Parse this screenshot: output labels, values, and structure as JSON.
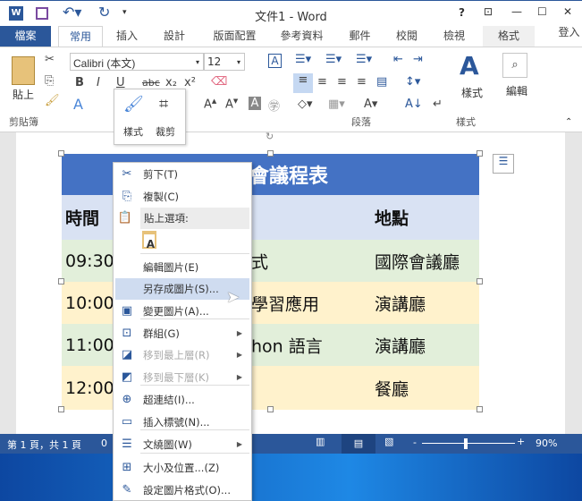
{
  "titlebar": {
    "title": "文件1 - Word",
    "help": "?",
    "restore_ribbon": "⊡",
    "minimize": "—",
    "maximize": "☐",
    "close": "✕"
  },
  "tabs": {
    "file": "檔案",
    "items": [
      "常用",
      "插入",
      "設計",
      "版面配置",
      "參考資料",
      "郵件",
      "校閱",
      "檢視",
      "格式"
    ],
    "signin": "登入"
  },
  "ribbon": {
    "clipboard": {
      "paste": "貼上",
      "label": "剪貼簿"
    },
    "font": {
      "name": "Calibri (本文)",
      "size": "12",
      "bold": "B",
      "italic": "I",
      "underline": "U",
      "strike": "abc",
      "sub": "x₂",
      "sup": "x²"
    },
    "paragraph": {
      "label": "段落"
    },
    "styles": {
      "button": "樣式",
      "label": "樣式"
    },
    "editing": {
      "button": "編輯"
    }
  },
  "mini_toolbar": {
    "style": "樣式",
    "crop": "裁剪"
  },
  "table": {
    "title": "會議程表",
    "headers": [
      "時間",
      "",
      "地點"
    ],
    "rows": [
      [
        "09:30",
        "式",
        "國際會議廳"
      ],
      [
        "10:00",
        "學習應用",
        "演講廳"
      ],
      [
        "11:00",
        "hon 語言",
        "演講廳"
      ],
      [
        "12:00",
        "",
        "餐廳"
      ]
    ],
    "colors": {
      "title": "#4472c4",
      "header": "#d9e2f3",
      "green": "#e2efda",
      "yellow": "#fff2cc"
    }
  },
  "context_menu": {
    "items": [
      {
        "label": "剪下(T)",
        "icon": "✂"
      },
      {
        "label": "複製(C)",
        "icon": "⎘"
      },
      {
        "label": "貼上選項:",
        "icon": "📋"
      },
      {
        "label": "編輯圖片(E)"
      },
      {
        "label": "另存成圖片(S)...",
        "highlighted": true
      },
      {
        "label": "變更圖片(A)...",
        "icon": "▣"
      },
      {
        "label": "群組(G)",
        "icon": "⊡",
        "submenu": true
      },
      {
        "label": "移到最上層(R)",
        "icon": "◪",
        "disabled": true,
        "submenu": true
      },
      {
        "label": "移到最下層(K)",
        "icon": "◩",
        "disabled": true,
        "submenu": true
      },
      {
        "label": "超連結(I)...",
        "icon": "⊕"
      },
      {
        "label": "插入標號(N)...",
        "icon": "▭"
      },
      {
        "label": "文繞圖(W)",
        "icon": "☰",
        "submenu": true
      },
      {
        "label": "大小及位置...(Z)",
        "icon": "⊞"
      },
      {
        "label": "設定圖片格式(O)...",
        "icon": "✎"
      }
    ]
  },
  "status": {
    "page": "第 1 頁，共 1 頁",
    "words": "0",
    "zoom": "90%",
    "zoom_fraction": 0.45
  }
}
